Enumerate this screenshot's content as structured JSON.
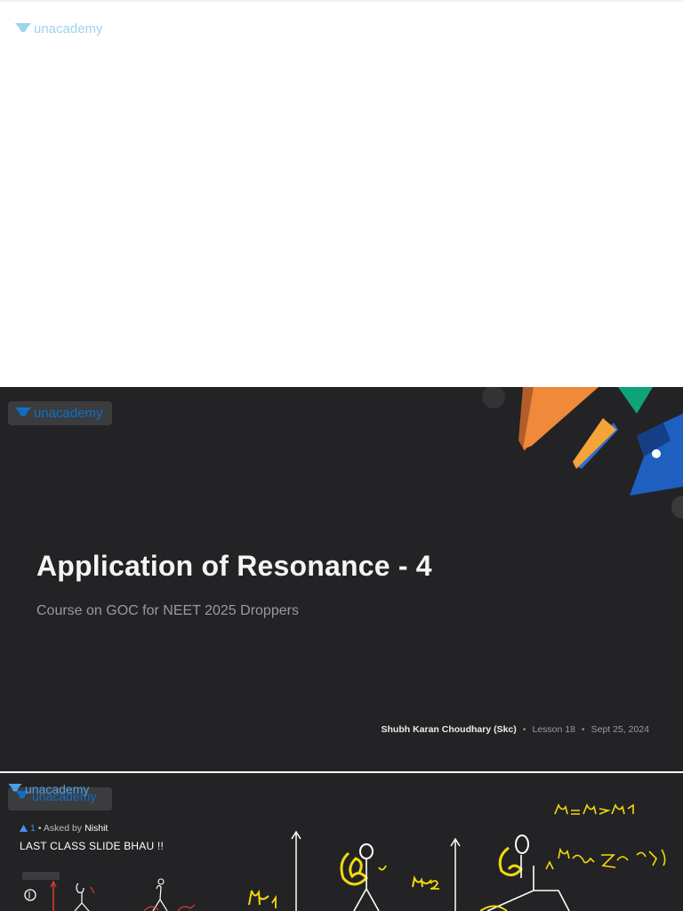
{
  "brand": {
    "name": "unacademy",
    "color": "#08bd80"
  },
  "slide": {
    "title": "Application of Resonance - 4",
    "subtitle": "Course on GOC for NEET 2025 Droppers",
    "educator": "Shubh Karan Choudhary (Skc)",
    "lesson": "Lesson 18",
    "date": "Sept 25, 2024",
    "separator": "•"
  },
  "question": {
    "upvote_icon": "triangle-up-icon",
    "votes": "1",
    "asked_by_prefix": "• Asked by",
    "asker": "Nishit",
    "text": "LAST CLASS SLIDE BHAU !!"
  },
  "colors": {
    "slide_bg": "#232325",
    "ink_yellow": "#f5d90a",
    "ink_white": "#ffffff",
    "ink_red": "#e23a2e",
    "accent_orange": "#f08a3a",
    "accent_blue": "#1f5fbf",
    "accent_green": "#0fa37a"
  }
}
